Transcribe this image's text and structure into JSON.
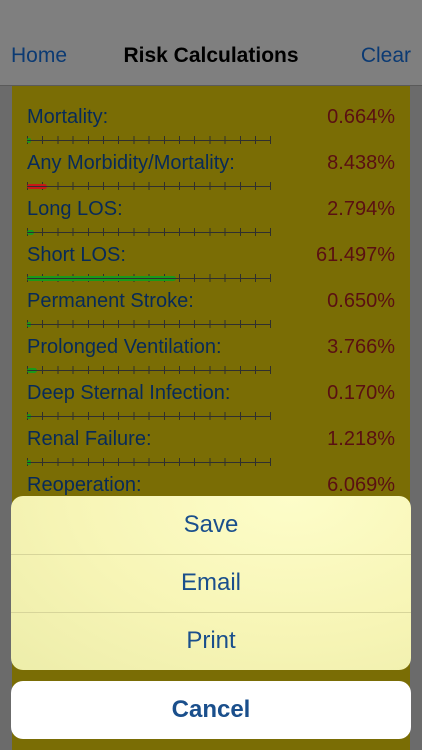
{
  "nav": {
    "left": "Home",
    "title": "Risk Calculations",
    "right": "Clear"
  },
  "risks": [
    {
      "label": "Mortality:",
      "value": "0.664%",
      "fraction": 0.01,
      "color": "#1a9a1a"
    },
    {
      "label": "Any Morbidity/Mortality:",
      "value": "8.438%",
      "fraction": 0.08,
      "color": "#c81818"
    },
    {
      "label": "Long LOS:",
      "value": "2.794%",
      "fraction": 0.03,
      "color": "#1a9a1a"
    },
    {
      "label": "Short LOS:",
      "value": "61.497%",
      "fraction": 0.61,
      "color": "#1a9a1a"
    },
    {
      "label": "Permanent Stroke:",
      "value": "0.650%",
      "fraction": 0.01,
      "color": "#1a9a1a"
    },
    {
      "label": "Prolonged Ventilation:",
      "value": "3.766%",
      "fraction": 0.04,
      "color": "#1a9a1a"
    },
    {
      "label": "Deep Sternal Infection:",
      "value": "0.170%",
      "fraction": 0.0,
      "color": "#1a9a1a"
    },
    {
      "label": "Renal Failure:",
      "value": "1.218%",
      "fraction": 0.01,
      "color": "#1a9a1a"
    },
    {
      "label": "Reoperation:",
      "value": "6.069%",
      "fraction": 0.06,
      "color": "#1a9a1a"
    }
  ],
  "sheet": {
    "save": "Save",
    "email": "Email",
    "print": "Print",
    "cancel": "Cancel"
  }
}
